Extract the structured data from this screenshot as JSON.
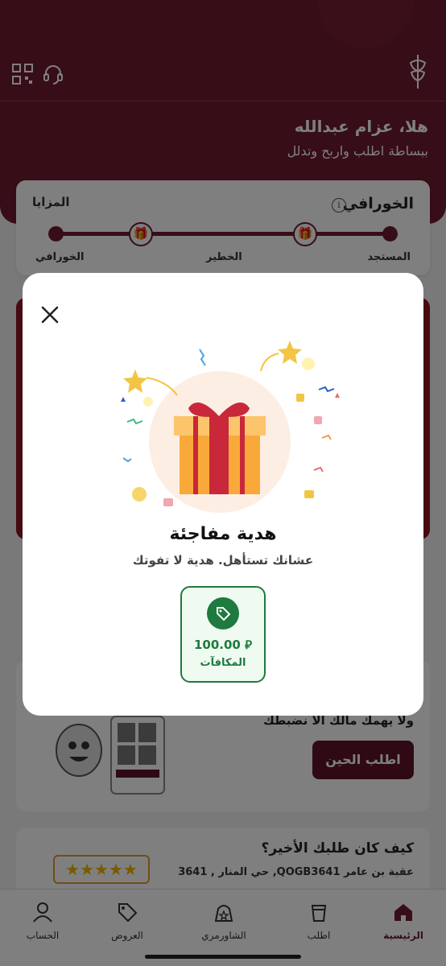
{
  "header": {
    "greeting": "هلا، عزام عبدالله",
    "subtitle": "ببساطة اطلب واربح وتدلل"
  },
  "tier": {
    "title": "الخورافي",
    "benefits_link": "المزايا",
    "levels": [
      "المستجد",
      "الخطير",
      "الخورافي"
    ]
  },
  "promo": {
    "text": "ولا يهمك مالك الا نضبطك",
    "button": "اطلب الحين"
  },
  "rating": {
    "title": "كيف كان طلبك الأخير؟",
    "address": "حي المنار , 3641 ,QOGB3641 عقبة بن عامر",
    "stars": "★★★★★"
  },
  "modal": {
    "title": "هدية مفاجئة",
    "subtitle": "عشانك تستأهل. هدية لا تفوتك",
    "reward_amount": "100.00 ⃁",
    "reward_label": "المكافآت"
  },
  "tabs": [
    {
      "label": "الرئيسية"
    },
    {
      "label": "اطلب"
    },
    {
      "label": "الشاورمري"
    },
    {
      "label": "العروض"
    },
    {
      "label": "الحساب"
    }
  ],
  "colors": {
    "brand": "#6e1a30",
    "reward_green": "#1e7a3e",
    "overlay": "rgba(0,0,0,0.5)"
  }
}
